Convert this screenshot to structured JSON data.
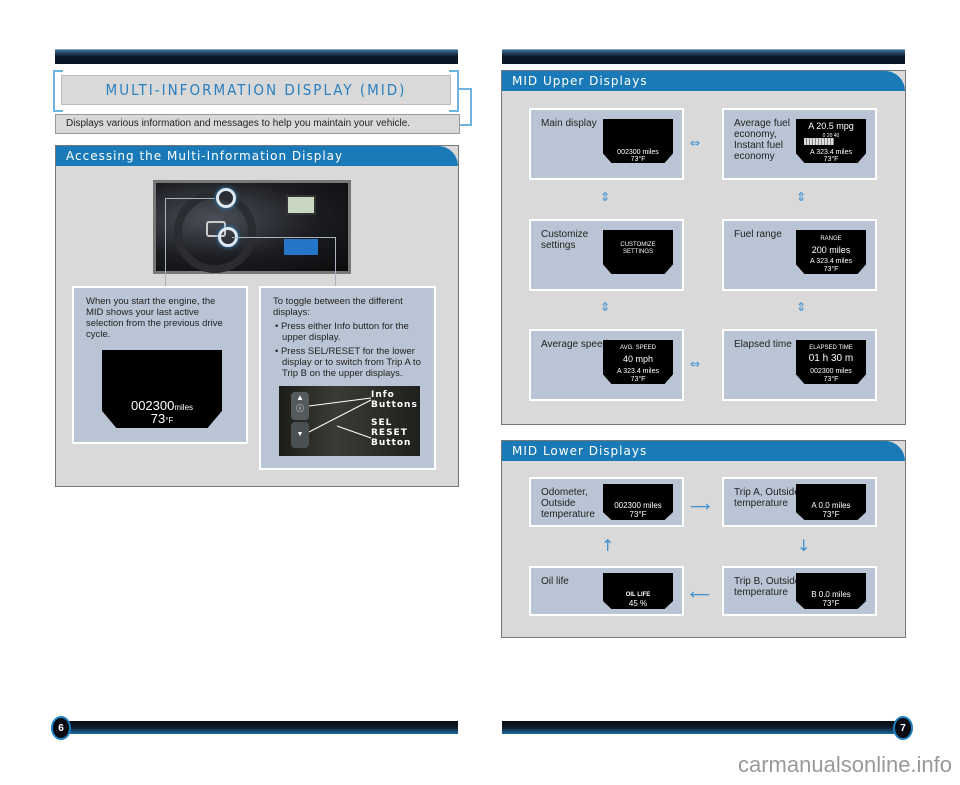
{
  "page_left": {
    "number": "6",
    "title": "MULTI-INFORMATION DISPLAY (MID)",
    "intro": "Displays various information and messages to help you maintain your vehicle.",
    "section": {
      "heading": "Accessing the Multi-Information Display",
      "left_box": {
        "text": "When you start the engine, the MID shows your last active selection from the previous drive cycle.",
        "lcd": {
          "odometer": "002300",
          "odometer_unit": "miles",
          "temp": "73",
          "temp_unit": "°F"
        }
      },
      "right_box": {
        "intro": "To toggle between the different displays:",
        "bullets": [
          "Press either Info button for the upper display.",
          "Press SEL/RESET for the lower display or to switch from Trip A to Trip B on the upper displays."
        ],
        "photo_labels": {
          "info": "Info\nButtons",
          "info_line1": "Info",
          "info_line2": "Buttons",
          "sel_line1": "SEL",
          "sel_line2": "RESET",
          "sel_line3": "Button"
        }
      }
    }
  },
  "page_right": {
    "number": "7",
    "upper": {
      "heading": "MID Upper Displays",
      "cards": [
        {
          "label": "Main display",
          "lcd": [
            "",
            "",
            "002300 miles",
            "73°F"
          ]
        },
        {
          "label": "Average fuel economy, Instant fuel economy",
          "lcd": [
            "A 20.5 mpg",
            "0  20  40",
            "A 323.4 miles",
            "73°F"
          ]
        },
        {
          "label": "Customize settings",
          "lcd": [
            "CUSTOMIZE",
            "SETTINGS",
            "",
            ""
          ]
        },
        {
          "label": "Fuel range",
          "lcd": [
            "RANGE",
            "200 miles",
            "A 323.4 miles",
            "73°F"
          ]
        },
        {
          "label": "Average speed",
          "lcd": [
            "AVG. SPEED",
            "40 mph",
            "A 323.4 miles",
            "73°F"
          ]
        },
        {
          "label": "Elapsed time",
          "lcd": [
            "ELAPSED TIME",
            "01 h 30 m",
            "002300 miles",
            "73°F"
          ]
        }
      ]
    },
    "lower": {
      "heading": "MID Lower Displays",
      "cards": [
        {
          "label": "Odometer, Outside temperature",
          "lcd": [
            "",
            "002300 miles",
            "73°F"
          ]
        },
        {
          "label": "Trip A, Outside temperature",
          "lcd": [
            "",
            "A   0.0 miles",
            "73°F"
          ]
        },
        {
          "label": "Oil life",
          "lcd": [
            "",
            "OIL LIFE",
            "45 %"
          ]
        },
        {
          "label": "Trip B, Outside temperature",
          "lcd": [
            "",
            "B   0.0 miles",
            "73°F"
          ]
        }
      ]
    }
  },
  "watermark": "carmanualsonline.info"
}
